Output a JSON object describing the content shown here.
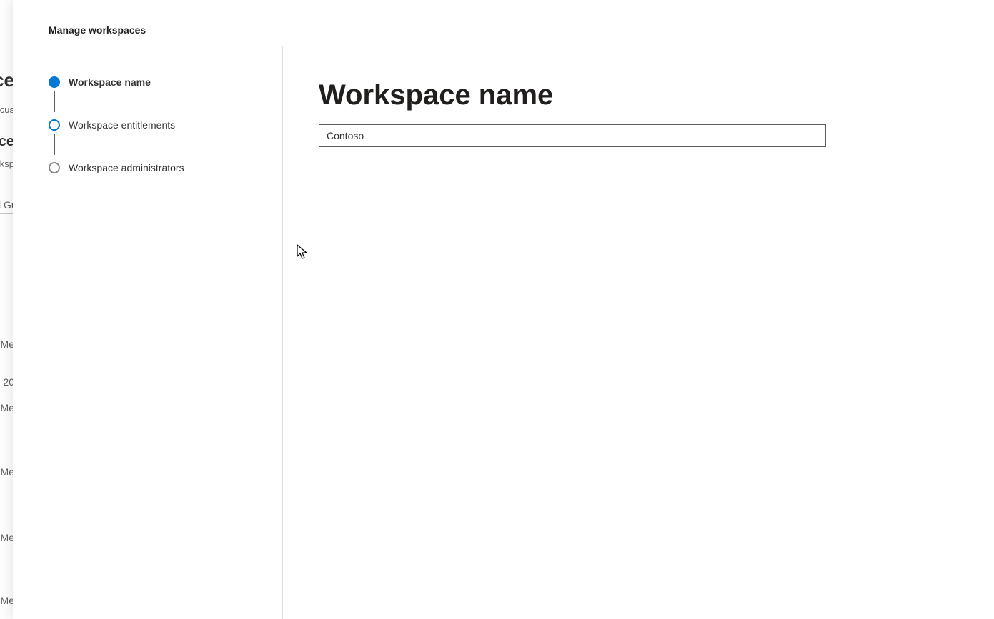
{
  "background_peek": {
    "frag1": "ce",
    "frag2": "cus",
    "frag3": "ce",
    "frag4": "rksp",
    "frag5": "l Gu",
    "frag6": "Me",
    "frag7": "20",
    "frag8": "Me",
    "frag9": "Me",
    "frag10": "Me",
    "frag11": "Me"
  },
  "header": {
    "title": "Manage workspaces"
  },
  "steps": [
    {
      "label": "Workspace name",
      "state": "filled",
      "active": true
    },
    {
      "label": "Workspace entitlements",
      "state": "ring",
      "active": false
    },
    {
      "label": "Workspace administrators",
      "state": "empty",
      "active": false
    }
  ],
  "content": {
    "title": "Workspace name",
    "input_value": "Contoso"
  }
}
